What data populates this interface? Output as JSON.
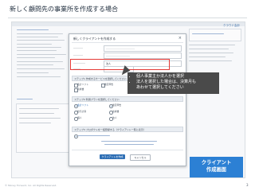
{
  "slide": {
    "title": "新しく顧問先の事業所を作成する場合",
    "copyright": "© Money Forward, Inc. All Rights Reserved.",
    "page_number": "3"
  },
  "background_page": {
    "brand": "クラウド会計"
  },
  "modal": {
    "title": "新しくクライアントを作成する",
    "close_icon": "close-icon",
    "section_type": "ステップ1 作成するサービスを選択してください",
    "section_plan": "ステップ2 利用プランを選択してください",
    "section_staff": "ステップ3 プロダクトを一括登録する（クライアント一覧に表示）",
    "create_button": "クライアントを作成",
    "cancel_button": "キャンセル",
    "radio_individual": "個人",
    "radio_corporate": "法人",
    "option_a": "会計ソフト",
    "option_b": "確定申告",
    "option_c": "給与計算",
    "option_d": "請求書"
  },
  "callout": {
    "items": [
      "個人事業主か法人かを選択",
      "法人を選択した場合は、決算月も",
      "あわせて選択してください"
    ]
  },
  "badge": {
    "line1": "クライアント",
    "line2": "作成画面"
  },
  "colors": {
    "highlight_red": "#e53935",
    "callout_bg": "#4a4a4a",
    "badge_blue": "#2c80d4",
    "accent_blue": "#2e6fb5"
  }
}
